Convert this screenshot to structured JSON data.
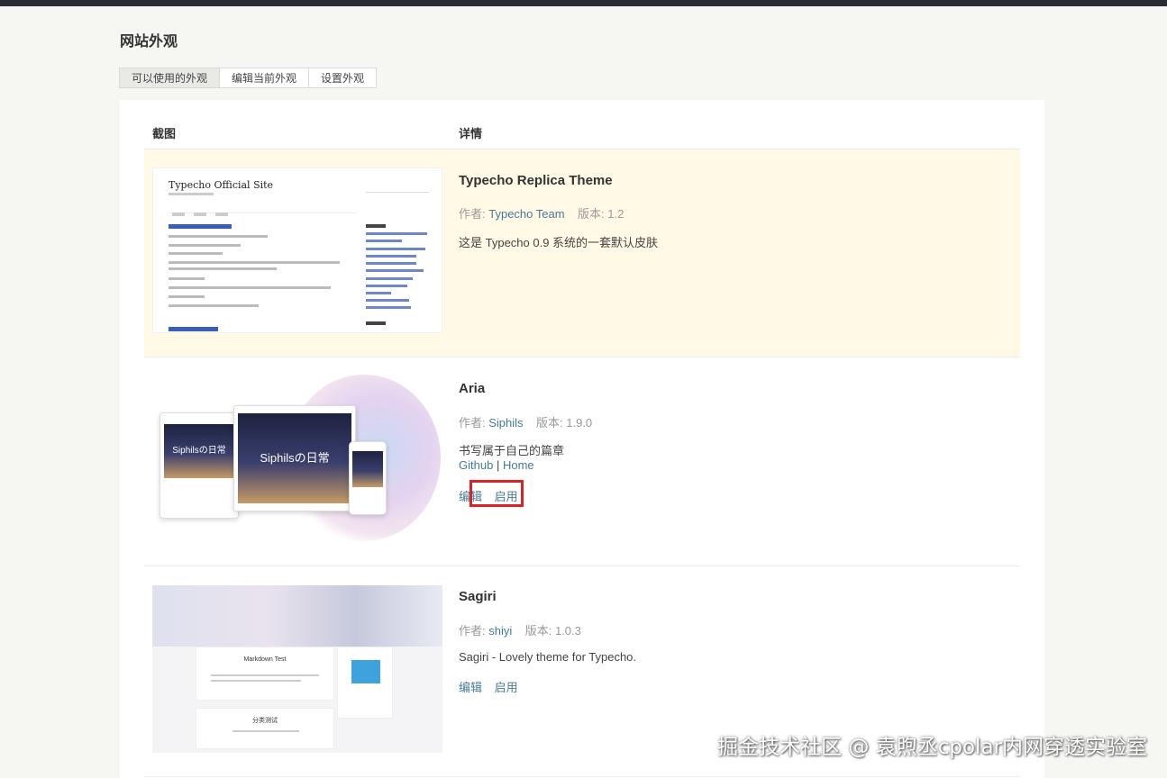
{
  "page": {
    "title": "网站外观"
  },
  "tabs": [
    {
      "label": "可以使用的外观",
      "active": true
    },
    {
      "label": "编辑当前外观",
      "active": false
    },
    {
      "label": "设置外观",
      "active": false
    }
  ],
  "table": {
    "headers": {
      "screenshot": "截图",
      "details": "详情"
    }
  },
  "themes": [
    {
      "name": "Typecho Replica Theme",
      "author_label": "作者:",
      "author": "Typecho Team",
      "version_label": "版本:",
      "version": "1.2",
      "description": "这是 Typecho 0.9 系统的一套默认皮肤",
      "current": true,
      "screenshot": {
        "site_title": "Typecho Official Site"
      }
    },
    {
      "name": "Aria",
      "author_label": "作者:",
      "author": "Siphils",
      "version_label": "版本:",
      "version": "1.9.0",
      "description": "书写属于自己的篇章",
      "links": [
        "Github",
        "Home"
      ],
      "link_separator": "|",
      "actions": {
        "edit": "编辑",
        "enable": "启用"
      },
      "screenshot": {
        "caption": "Siphilsの日常"
      }
    },
    {
      "name": "Sagiri",
      "author_label": "作者:",
      "author": "shiyi",
      "version_label": "版本:",
      "version": "1.0.3",
      "description": "Sagiri - Lovely theme for Typecho.",
      "actions": {
        "edit": "编辑",
        "enable": "启用"
      },
      "screenshot": {
        "card1_title": "Markdown Test",
        "card2_title": "分类测试"
      }
    }
  ],
  "watermark": "掘金技术社区 @ 袁煦丞cpolar内网穿透实验室",
  "colors": {
    "link": "#467b96",
    "highlight_box": "#d9232a",
    "current_row_bg": "#fff9e6",
    "topbar": "#292d33"
  }
}
